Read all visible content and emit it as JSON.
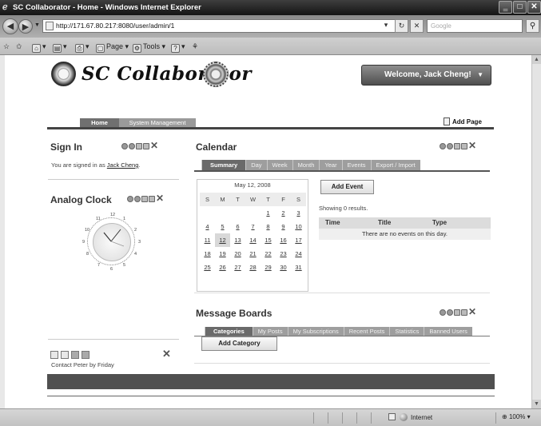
{
  "browser": {
    "window_title": "SC Collaborator - Home - Windows Internet Explorer",
    "url": "http://171.67.80.217:8080/user/admin/1",
    "search_placeholder": "Google",
    "menu": {
      "page": "Page",
      "tools": "Tools"
    },
    "status_zone": "Internet",
    "zoom": "100%"
  },
  "site": {
    "logo_text": "SC Collaborator",
    "welcome": "Welcome, Jack Cheng!",
    "nav": [
      {
        "label": "Home",
        "active": true
      },
      {
        "label": "System Management",
        "active": false
      }
    ],
    "add_page": "Add Page"
  },
  "sign_in": {
    "title": "Sign In",
    "text": "You are signed in as",
    "user": "Jack Cheng",
    "period": "."
  },
  "analog_clock": {
    "title": "Analog Clock",
    "numbers": [
      "12",
      "1",
      "2",
      "3",
      "4",
      "5",
      "6",
      "7",
      "8",
      "9",
      "10",
      "11"
    ]
  },
  "note": {
    "text": "Contact Peter by Friday"
  },
  "calendar": {
    "title": "Calendar",
    "tabs": [
      "Summary",
      "Day",
      "Week",
      "Month",
      "Year",
      "Events",
      "Export / Import"
    ],
    "active_tab": "Summary",
    "month_header": "May 12, 2008",
    "dow": [
      "S",
      "M",
      "T",
      "W",
      "T",
      "F",
      "S"
    ],
    "weeks": [
      [
        "",
        "",
        "",
        "",
        "1",
        "2",
        "3"
      ],
      [
        "4",
        "5",
        "6",
        "7",
        "8",
        "9",
        "10"
      ],
      [
        "11",
        "12",
        "13",
        "14",
        "15",
        "16",
        "17"
      ],
      [
        "18",
        "19",
        "20",
        "21",
        "22",
        "23",
        "24"
      ],
      [
        "25",
        "26",
        "27",
        "28",
        "29",
        "30",
        "31"
      ]
    ],
    "today": "12",
    "add_event": "Add Event",
    "showing": "Showing 0 results.",
    "columns": [
      "Time",
      "Title",
      "Type"
    ],
    "empty": "There are no events on this day."
  },
  "message_boards": {
    "title": "Message Boards",
    "tabs": [
      "Categories",
      "My Posts",
      "My Subscriptions",
      "Recent Posts",
      "Statistics",
      "Banned Users"
    ],
    "active_tab": "Categories",
    "add_category": "Add Category"
  },
  "colors": {
    "accent": "#6a6a6a",
    "tab_inactive": "#9e9e9e",
    "footer": "#505050"
  }
}
